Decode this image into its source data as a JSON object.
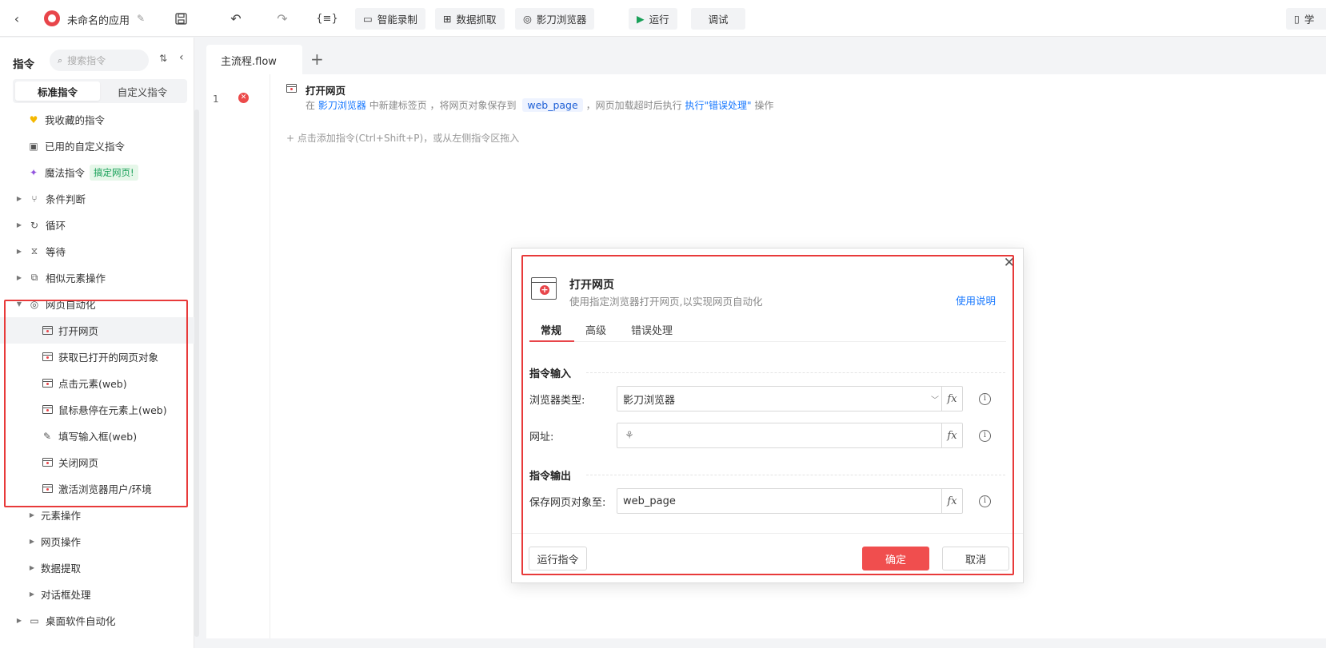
{
  "header": {
    "app_name": "未命名的应用",
    "toolbar": {
      "smart_record": "智能录制",
      "data_capture": "数据抓取",
      "browser": "影刀浏览器",
      "run": "运行",
      "debug": "调试",
      "right_label": "学"
    }
  },
  "sidebar": {
    "title": "指令",
    "search_placeholder": "搜索指令",
    "tabs": [
      "标准指令",
      "自定义指令"
    ],
    "items": [
      {
        "label": "我收藏的指令",
        "icon": "heart-icon"
      },
      {
        "label": "已用的自定义指令",
        "icon": "bag-icon"
      },
      {
        "label": "魔法指令",
        "icon": "sparkle-icon",
        "badge": "搞定网页!"
      },
      {
        "label": "条件判断",
        "icon": "branch-icon"
      },
      {
        "label": "循环",
        "icon": "loop-icon"
      },
      {
        "label": "等待",
        "icon": "hourglass-icon"
      },
      {
        "label": "相似元素操作",
        "icon": "similar-elements-icon"
      },
      {
        "label": "网页自动化",
        "icon": "browser-icon"
      },
      {
        "label": "打开网页",
        "icon": "open-webpage-icon"
      },
      {
        "label": "获取已打开的网页对象",
        "icon": "get-webpage-icon"
      },
      {
        "label": "点击元素(web)",
        "icon": "click-element-icon"
      },
      {
        "label": "鼠标悬停在元素上(web)",
        "icon": "hover-element-icon"
      },
      {
        "label": "填写输入框(web)",
        "icon": "fill-input-icon"
      },
      {
        "label": "关闭网页",
        "icon": "close-webpage-icon"
      },
      {
        "label": "激活浏览器用户/环境",
        "icon": "activate-browser-icon"
      },
      {
        "label": "元素操作"
      },
      {
        "label": "网页操作"
      },
      {
        "label": "数据提取"
      },
      {
        "label": "对话框处理"
      },
      {
        "label": "桌面软件自动化",
        "icon": "desktop-icon"
      }
    ]
  },
  "editor": {
    "tab": "主流程.flow",
    "line_number": "1",
    "step": {
      "title": "打开网页",
      "desc_1": "在",
      "desc_browser": "影刀浏览器",
      "desc_2": "中新建标签页 ，将网页对象保存到",
      "desc_var": "web_page",
      "desc_3": "，网页加载超时后执行",
      "desc_action": "执行\"错误处理\"",
      "desc_4": "操作"
    },
    "add_hint": "点击添加指令(Ctrl+Shift+P)，或从左侧指令区拖入"
  },
  "dialog": {
    "title": "打开网页",
    "subtitle": "使用指定浏览器打开网页,以实现网页自动化",
    "help_link": "使用说明",
    "tabs": [
      "常规",
      "高级",
      "错误处理"
    ],
    "input_section": "指令输入",
    "output_section": "指令输出",
    "fields": {
      "browser_type_label": "浏览器类型:",
      "browser_type_value": "影刀浏览器",
      "url_label": "网址:",
      "url_value": "",
      "save_label": "保存网页对象至:",
      "save_value": "web_page"
    },
    "buttons": {
      "run": "运行指令",
      "ok": "确定",
      "cancel": "取消"
    }
  },
  "colors": {
    "accent_red": "#f04e4e",
    "link_blue": "#1677ff",
    "highlight_box": "#e83a3a"
  }
}
